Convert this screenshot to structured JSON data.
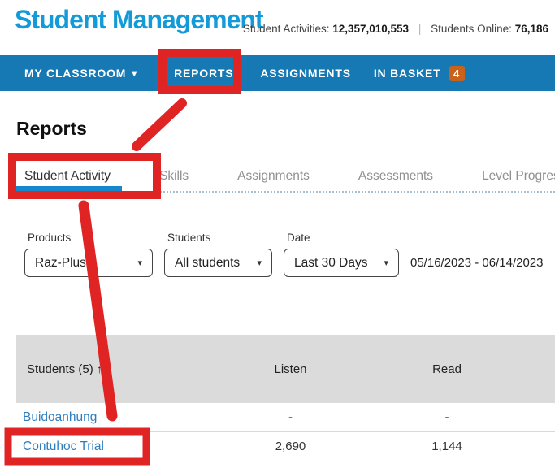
{
  "header": {
    "logo": "Student Management",
    "stats": [
      {
        "label": "Student Activities:",
        "value": "12,357,010,553"
      },
      {
        "label": "Students Online:",
        "value": "76,186"
      }
    ],
    "separator": "|"
  },
  "nav": {
    "items": [
      {
        "label": "MY CLASSROOM"
      },
      {
        "label": "REPORTS"
      },
      {
        "label": "ASSIGNMENTS"
      },
      {
        "label": "IN BASKET",
        "badge": "4"
      }
    ]
  },
  "page": {
    "title": "Reports"
  },
  "tabs": [
    {
      "label": "Student Activity",
      "active": true
    },
    {
      "label": "Skills"
    },
    {
      "label": "Assignments"
    },
    {
      "label": "Assessments"
    },
    {
      "label": "Level Progress"
    }
  ],
  "filters": {
    "products": {
      "label": "Products",
      "value": "Raz-Plus"
    },
    "students": {
      "label": "Students",
      "value": "All students"
    },
    "date": {
      "label": "Date",
      "value": "Last 30 Days"
    },
    "date_range": "05/16/2023 - 06/14/2023"
  },
  "table": {
    "columns": {
      "students": "Students (5)",
      "listen": "Listen",
      "read": "Read"
    },
    "rows": [
      {
        "student": "Buidoanhung",
        "listen": "-",
        "read": "-"
      },
      {
        "student": "Contuhoc Trial",
        "listen": "2,690",
        "read": "1,144"
      }
    ]
  },
  "icons": {
    "caret_down": "▾",
    "dropdown_caret": "▾",
    "sort_up": "↑"
  },
  "colors": {
    "nav_blue": "#1779b4",
    "logo_blue": "#129bd8",
    "link_blue": "#2e7ebe",
    "tab_underline_blue": "#1687cb",
    "badge_orange": "#c9621c",
    "table_header_gray": "#dbdbdb",
    "annotation_red": "#e02424"
  },
  "annotations": {
    "color": "#e02424"
  }
}
